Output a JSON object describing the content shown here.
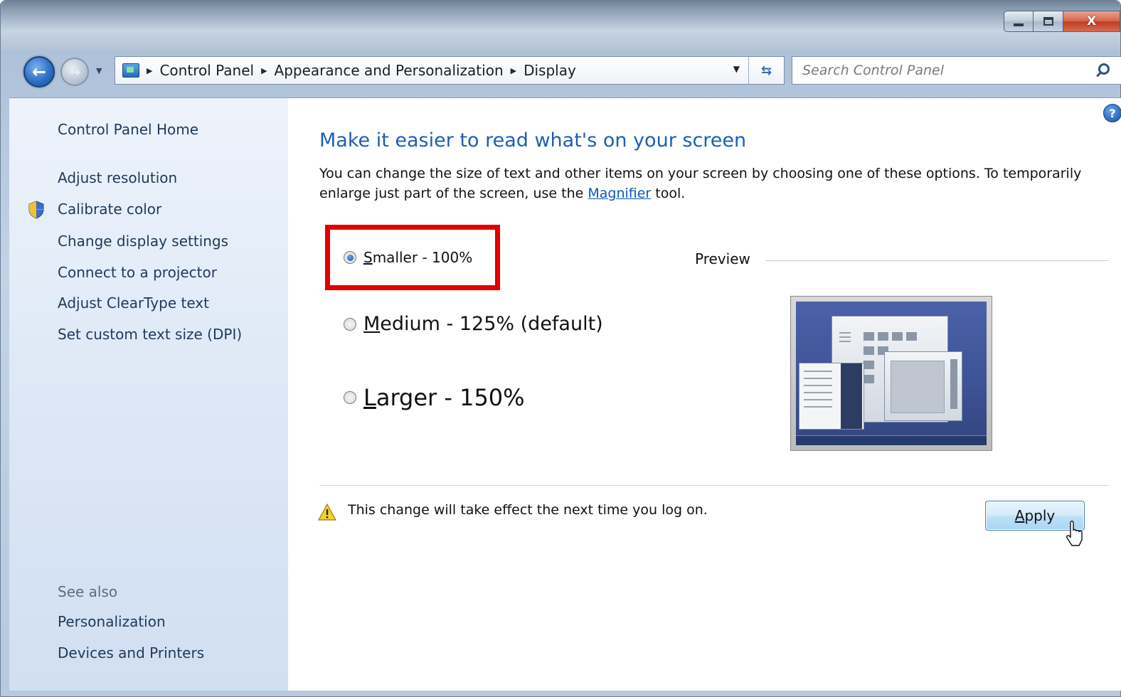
{
  "window": {
    "caption": {
      "minimize": "",
      "maximize": "",
      "close": "X"
    }
  },
  "nav": {
    "back_label": "←",
    "forward_label": "→",
    "breadcrumb": [
      "Control Panel",
      "Appearance and Personalization",
      "Display"
    ],
    "search_placeholder": "Search Control Panel"
  },
  "sidebar": {
    "home": "Control Panel Home",
    "links": [
      "Adjust resolution",
      "Calibrate color",
      "Change display settings",
      "Connect to a projector",
      "Adjust ClearType text",
      "Set custom text size (DPI)"
    ],
    "see_also_label": "See also",
    "see_also_links": [
      "Personalization",
      "Devices and Printers"
    ]
  },
  "main": {
    "help": "?",
    "title": "Make it easier to read what's on your screen",
    "desc_before": "You can change the size of text and other items on your screen by choosing one of these options. To temporarily enlarge just part of the screen, use the ",
    "desc_link": "Magnifier",
    "desc_after": " tool.",
    "options": [
      {
        "mnemonic": "S",
        "rest": "maller - 100%",
        "checked": true
      },
      {
        "mnemonic": "M",
        "rest": "edium - 125% (default)",
        "checked": false
      },
      {
        "mnemonic": "L",
        "rest": "arger - 150%",
        "checked": false
      }
    ],
    "preview_label": "Preview",
    "warning": "This change will take effect the next time you log on.",
    "apply_mnemonic": "A",
    "apply_rest": "pply"
  },
  "colors": {
    "accent_title": "#1e5fb3",
    "highlight": "#e00000",
    "link": "#0b57c2"
  }
}
